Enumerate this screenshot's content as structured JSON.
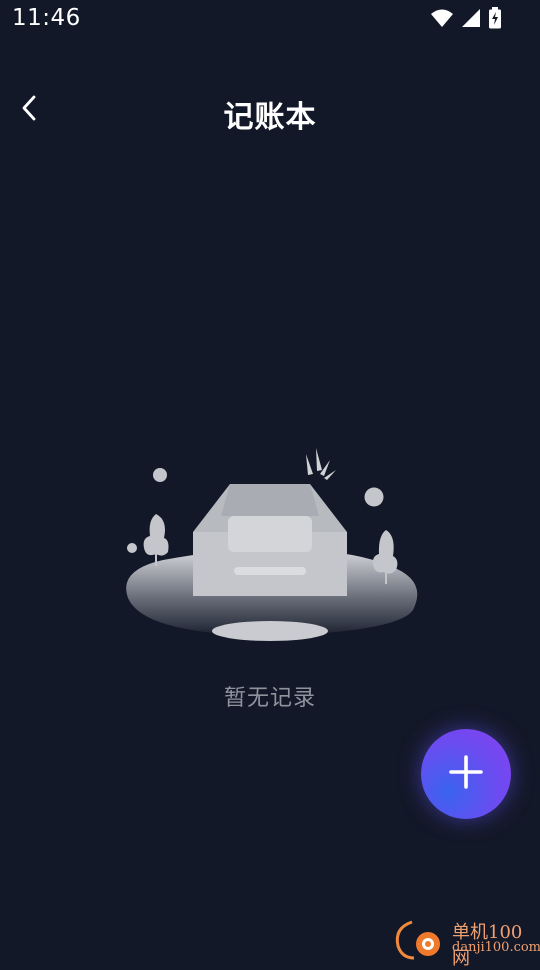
{
  "status_bar": {
    "time": "11:46",
    "icons": [
      "wifi-icon",
      "cellular-signal-icon",
      "battery-charging-icon"
    ]
  },
  "header": {
    "title": "记账本",
    "back_icon": "chevron-left-icon"
  },
  "empty_state": {
    "message": "暂无记录",
    "illustration": "empty-inbox-illustration"
  },
  "fab": {
    "icon": "plus-icon"
  },
  "watermark": {
    "brand": "单机100网",
    "domain": "danji100.com"
  },
  "colors": {
    "background": "#131828",
    "title_text": "#ffffff",
    "empty_text": "#8f939e",
    "fab_gradient_start": "#3a63f0",
    "fab_gradient_end": "#8a3ff0",
    "watermark": "#f0a070"
  }
}
